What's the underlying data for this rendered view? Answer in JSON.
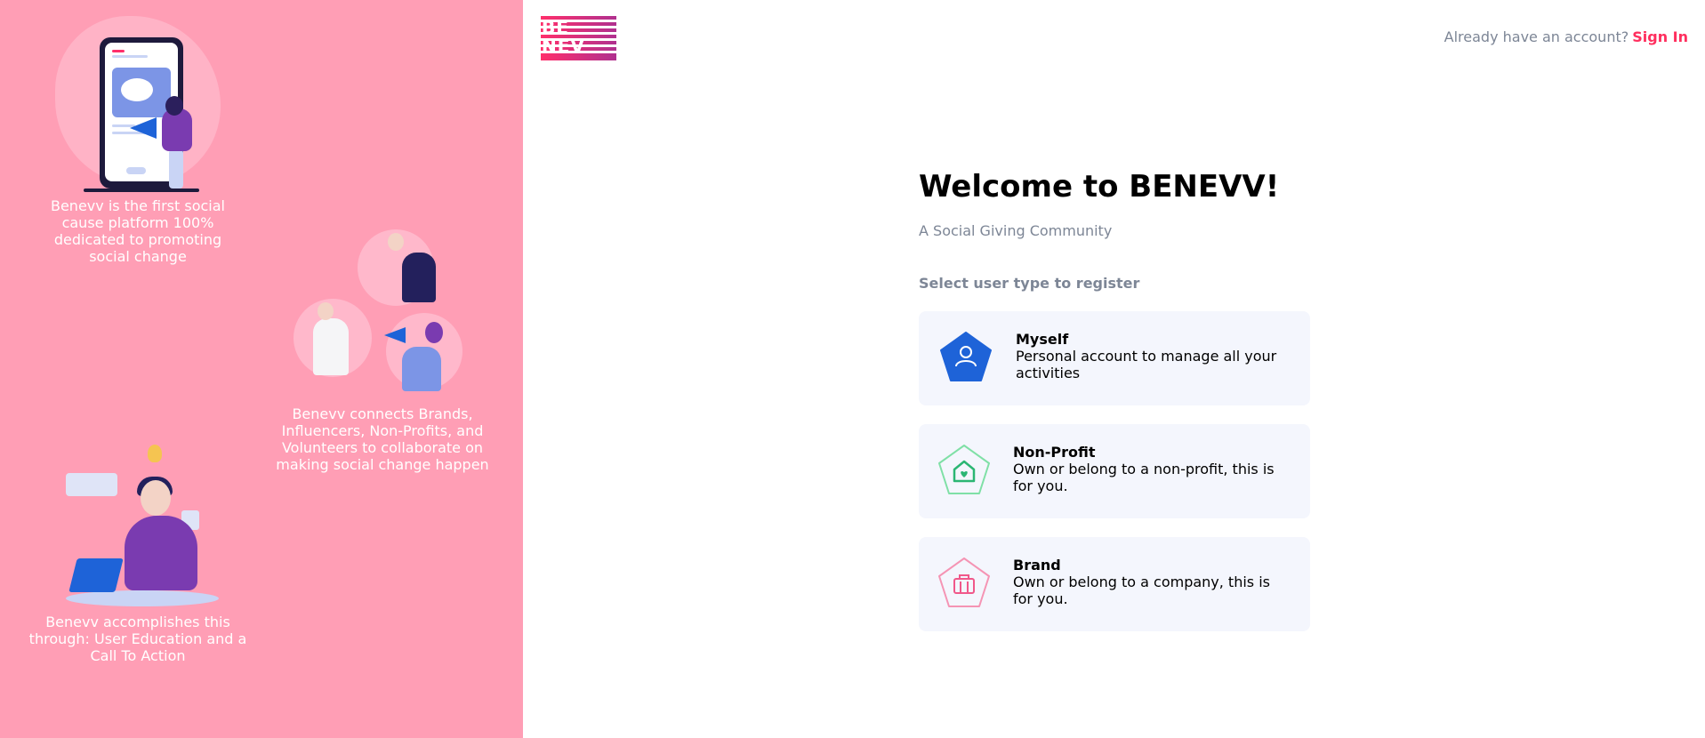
{
  "left_panel": {
    "captions": [
      "Benevv is the first social cause platform 100% dedicated to promoting social change",
      "Benevv connects Brands, Influencers, Non-Profits, and Volunteers to collaborate on making social change happen",
      "Benevv accomplishes this through: User Education and a Call To Action"
    ],
    "background_color": "#ff9eb5"
  },
  "header": {
    "logo_line1": "BE",
    "logo_line2": "NEV",
    "account_prompt": "Already have an account?",
    "sign_in_label": "Sign In",
    "accent_color": "#ff2f5e"
  },
  "main": {
    "title": "Welcome to BENEVV!",
    "subtitle": "A Social Giving Community",
    "select_label": "Select user type to register",
    "user_types": [
      {
        "title": "Myself",
        "description": "Personal account to manage all your activities",
        "icon": "user-icon",
        "color": "#1e63d8"
      },
      {
        "title": "Non-Profit",
        "description": "Own or belong to a non-profit, this is for you.",
        "icon": "house-heart-icon",
        "color": "#2bb673"
      },
      {
        "title": "Brand",
        "description": "Own or belong to a company, this is for you.",
        "icon": "briefcase-icon",
        "color": "#f0588a"
      }
    ]
  }
}
